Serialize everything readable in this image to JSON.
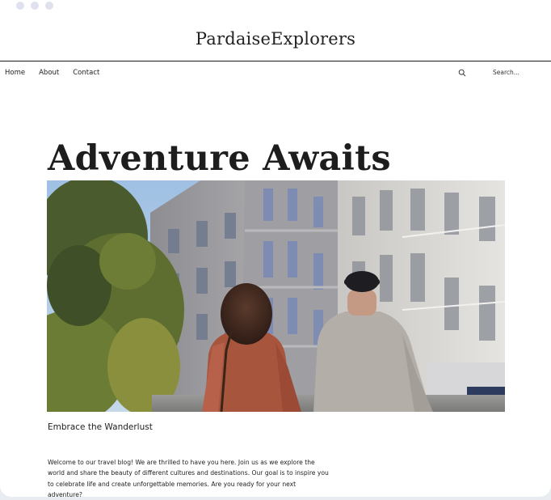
{
  "site": {
    "brand": "PardaiseExplorers"
  },
  "nav": {
    "items": [
      {
        "label": "Home"
      },
      {
        "label": "About"
      },
      {
        "label": "Contact"
      }
    ],
    "search_icon": "search-icon",
    "search_placeholder": "Search..."
  },
  "hero": {
    "title": "Adventure Awaits",
    "image_description_icon": "photo",
    "caption": "Embrace the Wanderlust"
  },
  "intro": {
    "text": "Welcome to our travel blog! We are thrilled to have you here. Join us as we explore the world and share the beauty of different cultures and destinations. Our goal is to inspire you to celebrate life and create unforgettable memories. Are you ready for your next adventure?"
  },
  "colors": {
    "background": "#ffffff",
    "text": "#222222",
    "window_dots": "#dfe2ee"
  }
}
